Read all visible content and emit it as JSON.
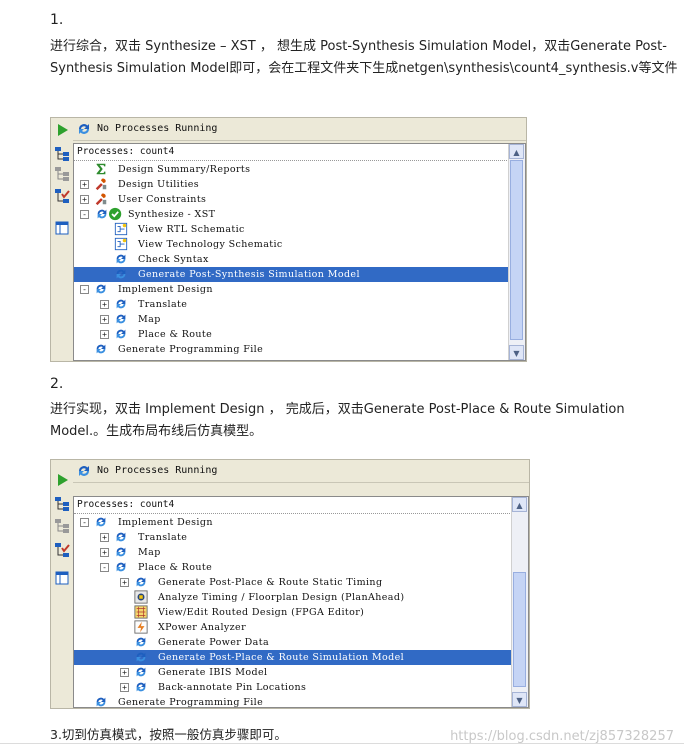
{
  "step1": {
    "number": "1.",
    "text": "进行综合，双击 Synthesize – XST ， 想生成 Post-Synthesis Simulation Model，双击Generate Post-Synthesis Simulation Model即可，会在工程文件夹下生成netgen\\synthesis\\count4_synthesis.v等文件",
    "panel": {
      "status": "No Processes Running",
      "processes_header": "Processes: count4",
      "tree": [
        {
          "label": "Design Summary/Reports",
          "icon": "sigma-icon",
          "expander": "",
          "level": 1
        },
        {
          "label": "Design Utilities",
          "icon": "tools-icon",
          "expander": "+",
          "level": 1
        },
        {
          "label": "User Constraints",
          "icon": "tools-icon",
          "expander": "+",
          "level": 1
        },
        {
          "label": "Synthesize - XST",
          "icon": "refresh-check-icon",
          "expander": "-",
          "level": 1
        },
        {
          "label": "View RTL Schematic",
          "icon": "schematic-icon",
          "expander": "",
          "level": 2
        },
        {
          "label": "View Technology Schematic",
          "icon": "schematic-icon",
          "expander": "",
          "level": 2
        },
        {
          "label": "Check Syntax",
          "icon": "refresh-icon",
          "expander": "",
          "level": 2
        },
        {
          "label": "Generate Post-Synthesis Simulation Model",
          "icon": "refresh-icon",
          "expander": "",
          "level": 2,
          "selected": true
        },
        {
          "label": "Implement Design",
          "icon": "refresh-icon",
          "expander": "-",
          "level": 1
        },
        {
          "label": "Translate",
          "icon": "refresh-icon",
          "expander": "+",
          "level": 2
        },
        {
          "label": "Map",
          "icon": "refresh-icon",
          "expander": "+",
          "level": 2
        },
        {
          "label": "Place & Route",
          "icon": "refresh-icon",
          "expander": "+",
          "level": 2
        },
        {
          "label": "Generate Programming File",
          "icon": "refresh-icon",
          "expander": "",
          "level": 1
        }
      ]
    }
  },
  "step2": {
    "number": "2.",
    "text": "进行实现，双击 Implement Design ， 完成后，双击Generate Post-Place & Route Simulation Model.。生成布局布线后仿真模型。",
    "panel": {
      "status": "No Processes Running",
      "processes_header": "Processes: count4",
      "tree": [
        {
          "label": "Implement Design",
          "icon": "refresh-icon",
          "expander": "-",
          "level": 1
        },
        {
          "label": "Translate",
          "icon": "refresh-icon",
          "expander": "+",
          "level": 2
        },
        {
          "label": "Map",
          "icon": "refresh-icon",
          "expander": "+",
          "level": 2
        },
        {
          "label": "Place & Route",
          "icon": "refresh-icon",
          "expander": "-",
          "level": 2
        },
        {
          "label": "Generate Post-Place & Route Static Timing",
          "icon": "refresh-icon",
          "expander": "+",
          "level": 3
        },
        {
          "label": "Analyze Timing / Floorplan Design (PlanAhead)",
          "icon": "planahead-icon",
          "expander": "",
          "level": 3
        },
        {
          "label": "View/Edit Routed Design (FPGA Editor)",
          "icon": "fpga-editor-icon",
          "expander": "",
          "level": 3
        },
        {
          "label": "XPower Analyzer",
          "icon": "xpower-icon",
          "expander": "",
          "level": 3
        },
        {
          "label": "Generate Power Data",
          "icon": "refresh-icon",
          "expander": "",
          "level": 3
        },
        {
          "label": "Generate Post-Place & Route Simulation Model",
          "icon": "refresh-icon",
          "expander": "",
          "level": 3,
          "selected": true
        },
        {
          "label": "Generate IBIS Model",
          "icon": "refresh-icon",
          "expander": "+",
          "level": 3
        },
        {
          "label": "Back-annotate Pin Locations",
          "icon": "refresh-icon",
          "expander": "+",
          "level": 3
        },
        {
          "label": "Generate Programming File",
          "icon": "refresh-icon",
          "expander": "",
          "level": 1
        }
      ]
    }
  },
  "step3": {
    "text": "3.切到仿真模式，按照一般仿真步骤即可。"
  },
  "watermark": "https://blog.csdn.net/zj857328257",
  "colors": {
    "selection": "#316ac5",
    "panel_bg": "#ece9d8",
    "icon_blue": "#1e5fbf"
  }
}
